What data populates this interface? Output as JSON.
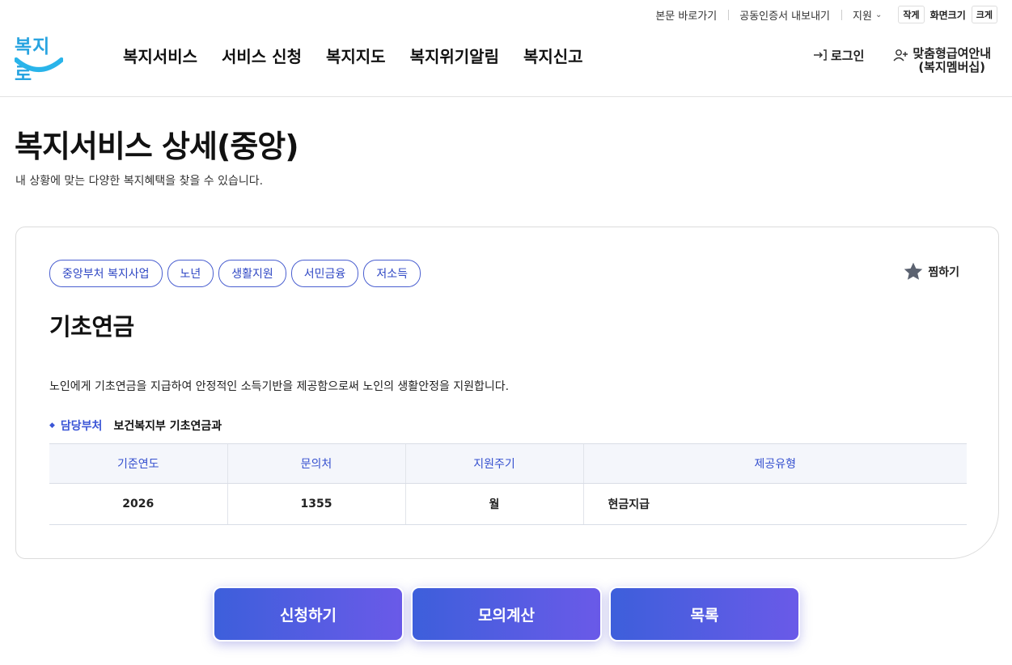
{
  "utility": {
    "skip_link": "본문 바로가기",
    "cert_export": "공동인증서 내보내기",
    "support": "지원",
    "size_small": "작게",
    "size_label": "화면크기",
    "size_large": "크게"
  },
  "header": {
    "logo_text": "복지로",
    "nav": [
      "복지서비스",
      "서비스 신청",
      "복지지도",
      "복지위기알림",
      "복지신고"
    ],
    "login": "로그인",
    "membership_line1": "맞춤형급여안내",
    "membership_line2": "(복지멤버십)"
  },
  "page": {
    "title": "복지서비스 상세(중앙)",
    "subtitle": "내 상황에 맞는 다양한 복지혜택을 찾을 수 있습니다."
  },
  "service": {
    "tags": [
      "중앙부처 복지사업",
      "노년",
      "생활지원",
      "서민금융",
      "저소득"
    ],
    "favorite": "찜하기",
    "name": "기초연금",
    "description": "노인에게 기초연금을 지급하여 안정적인 소득기반을 제공함으로써 노인의 생활안정을 지원합니다.",
    "dept_label": "담당부처",
    "dept_value": "보건복지부 기초연금과",
    "table": {
      "headers": [
        "기준연도",
        "문의처",
        "지원주기",
        "제공유형"
      ],
      "row": [
        "2026",
        "1355",
        "월",
        "현금지급"
      ]
    }
  },
  "actions": {
    "apply": "신청하기",
    "simulate": "모의계산",
    "list": "목록"
  },
  "colors": {
    "accent": "#3550cf",
    "logo": "#29a4e0",
    "button_start": "#3d5fdb",
    "button_end": "#6a5ae8"
  }
}
